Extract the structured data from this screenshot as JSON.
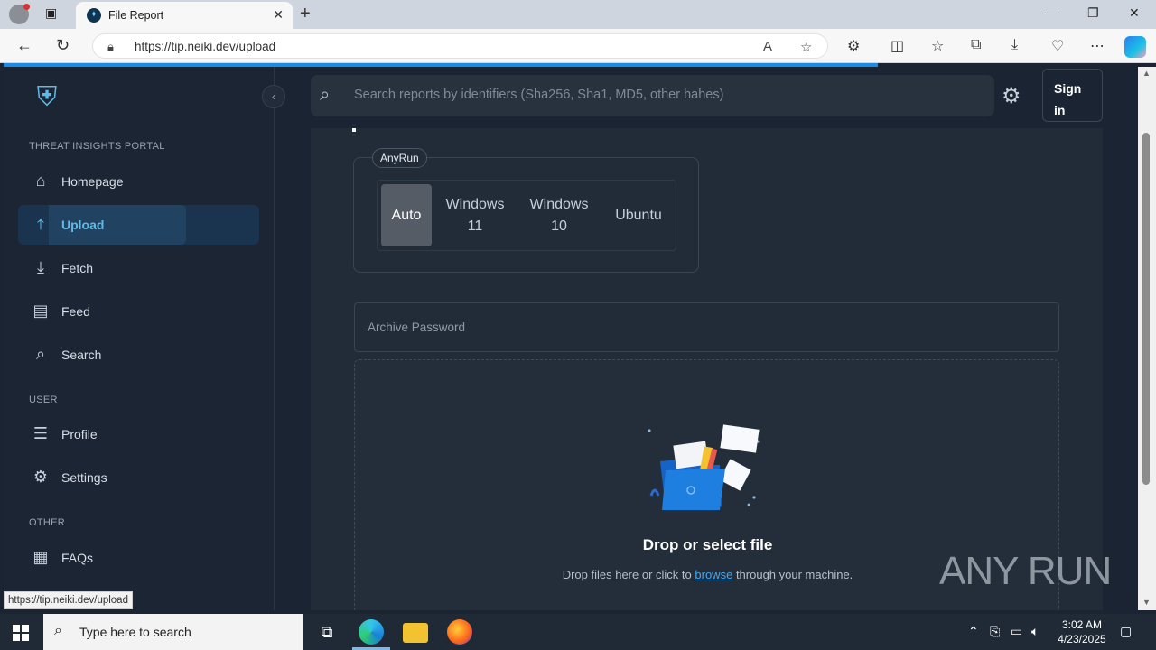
{
  "browser": {
    "tab_title": "File Report",
    "url": "https://tip.neiki.dev/upload",
    "status_url": "https://tip.neiki.dev/upload"
  },
  "sidebar": {
    "section_main": "THREAT INSIGHTS PORTAL",
    "section_user": "USER",
    "section_other": "OTHER",
    "items": [
      {
        "label": "Homepage",
        "icon": "home-icon"
      },
      {
        "label": "Upload",
        "icon": "upload-icon"
      },
      {
        "label": "Fetch",
        "icon": "download-icon"
      },
      {
        "label": "Feed",
        "icon": "feed-icon"
      },
      {
        "label": "Search",
        "icon": "search-icon"
      },
      {
        "label": "Profile",
        "icon": "profile-icon"
      },
      {
        "label": "Settings",
        "icon": "gear-icon"
      },
      {
        "label": "FAQs",
        "icon": "faq-icon"
      }
    ]
  },
  "header": {
    "search_placeholder": "Search reports by identifiers (Sha256, Sha1, MD5, other hahes)",
    "signin_line1": "Sign",
    "signin_line2": "in"
  },
  "upload": {
    "sandbox_label": "AnyRun",
    "os_options": [
      {
        "line1": "Auto",
        "line2": ""
      },
      {
        "line1": "Windows",
        "line2": "11"
      },
      {
        "line1": "Windows",
        "line2": "10"
      },
      {
        "line1": "Ubuntu",
        "line2": ""
      }
    ],
    "selected_os": "Auto",
    "archive_password_placeholder": "Archive Password",
    "dropzone_title": "Drop or select file",
    "dropzone_sub_before": "Drop files here or click to",
    "dropzone_link": "browse",
    "dropzone_sub_after": "through your machine."
  },
  "taskbar": {
    "search_text": "Type here to search",
    "time": "3:02 AM",
    "date": "4/23/2025"
  },
  "watermark": "ANY RUN",
  "colors": {
    "accent": "#5fbbe6",
    "page_bg": "#1b2432",
    "active_nav_bg": "#1a3450"
  }
}
